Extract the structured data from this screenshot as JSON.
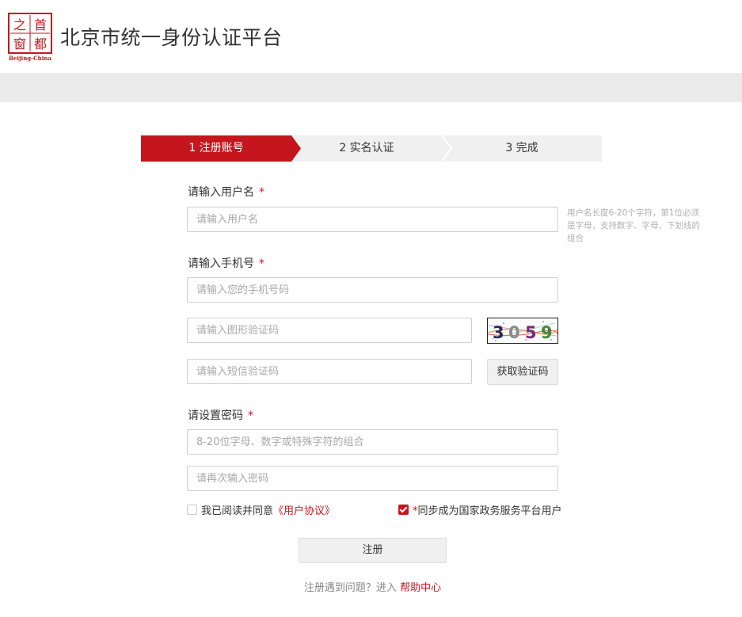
{
  "logo": {
    "chars": [
      "首",
      "都",
      "之",
      "窗"
    ],
    "subtitle": "Beijing-China"
  },
  "site_title": "北京市统一身份认证平台",
  "steps": [
    {
      "label": "1 注册账号",
      "active": true
    },
    {
      "label": "2 实名认证",
      "active": false
    },
    {
      "label": "3 完成",
      "active": false
    }
  ],
  "form": {
    "username": {
      "label": "请输入用户名",
      "required_mark": "*",
      "placeholder": "请输入用户名",
      "hint": "用户名长度6-20个字符，第1位必须是字母，支持数字、字母、下划线的组合"
    },
    "phone": {
      "label": "请输入手机号",
      "required_mark": "*",
      "placeholder": "请输入您的手机号码"
    },
    "captcha": {
      "placeholder": "请输入图形验证码",
      "image_text": "3059"
    },
    "sms": {
      "placeholder": "请输入短信验证码",
      "button": "获取验证码"
    },
    "password": {
      "label": "请设置密码",
      "required_mark": "*",
      "placeholder": "8-20位字母、数字或特殊字符的组合",
      "confirm_placeholder": "请再次输入密码"
    },
    "agree": {
      "text": "我已阅读并同意",
      "link": "《用户协议》",
      "checked": false
    },
    "sync": {
      "required_mark": "*",
      "text": "同步成为国家政务服务平台用户",
      "checked": true
    },
    "submit": "注册"
  },
  "footer": {
    "text": "注册遇到问题？进入",
    "link": "帮助中心"
  },
  "colors": {
    "accent": "#c4161c",
    "gray_band": "#ebebeb",
    "step_bg": "#f0f0f0"
  }
}
